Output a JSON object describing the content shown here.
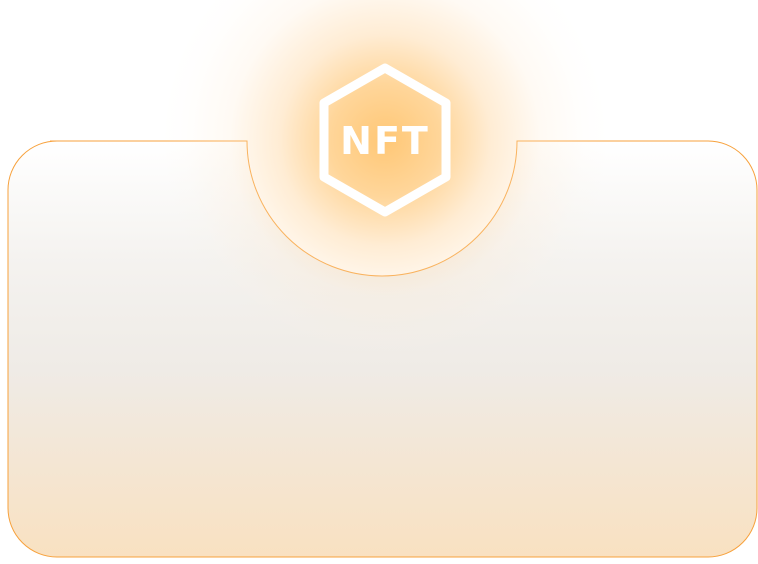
{
  "emblem": {
    "label": "NFT",
    "icon": "nft-hexagon-icon"
  },
  "colors": {
    "border": "#f7a13c",
    "glow": "#ffc46e",
    "card_top": "#ffffff",
    "card_mid": "#efece8",
    "card_bottom": "#f9e1c1"
  }
}
